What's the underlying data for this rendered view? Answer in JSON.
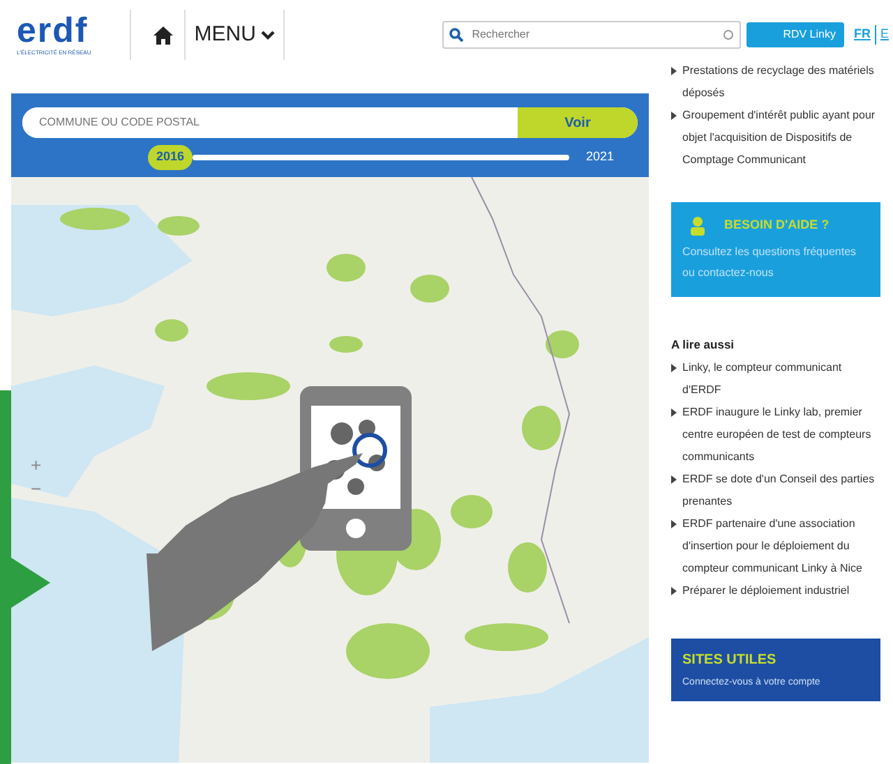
{
  "header": {
    "logo": {
      "word": "erdf",
      "tagline": "L'ÉLECTRICITÉ EN RÉSEAU"
    },
    "menu": "MENU",
    "search": {
      "placeholder": "Rechercher"
    },
    "cta": "RDV Linky",
    "languages": [
      {
        "label": "FR",
        "selected": true
      },
      {
        "label": "E",
        "selected": false
      }
    ]
  },
  "map_panel": {
    "search": {
      "placeholder": "COMMUNE OU CODE POSTAL",
      "button": "Voir"
    },
    "timeline": {
      "start": "2016",
      "end": "2021"
    },
    "zoom": [
      "+",
      "−"
    ]
  },
  "sidebar": {
    "top_links": [
      "Prestations de recyclage des matériels déposés",
      "Groupement d'intérêt public ayant pour objet l'acquisition de Dispositifs de Comptage Communicant"
    ],
    "help": {
      "title": "BESOIN D'AIDE ?",
      "text": "Consultez les questions fréquentes ou contactez-nous"
    },
    "read_more": {
      "title": "A lire aussi",
      "links": [
        "Linky, le compteur communicant d'ERDF",
        "ERDF inaugure le Linky lab, premier centre européen de test de compteurs communicants",
        "ERDF se dote d'un Conseil des parties prenantes",
        "ERDF partenaire d'une association d'insertion pour le déploiement du compteur communicant Linky à Nice",
        "Préparer le déploiement industriel"
      ]
    },
    "useful_sites": {
      "title": "SITES UTILES",
      "links": [
        "Connectez-vous à votre compte"
      ]
    }
  }
}
